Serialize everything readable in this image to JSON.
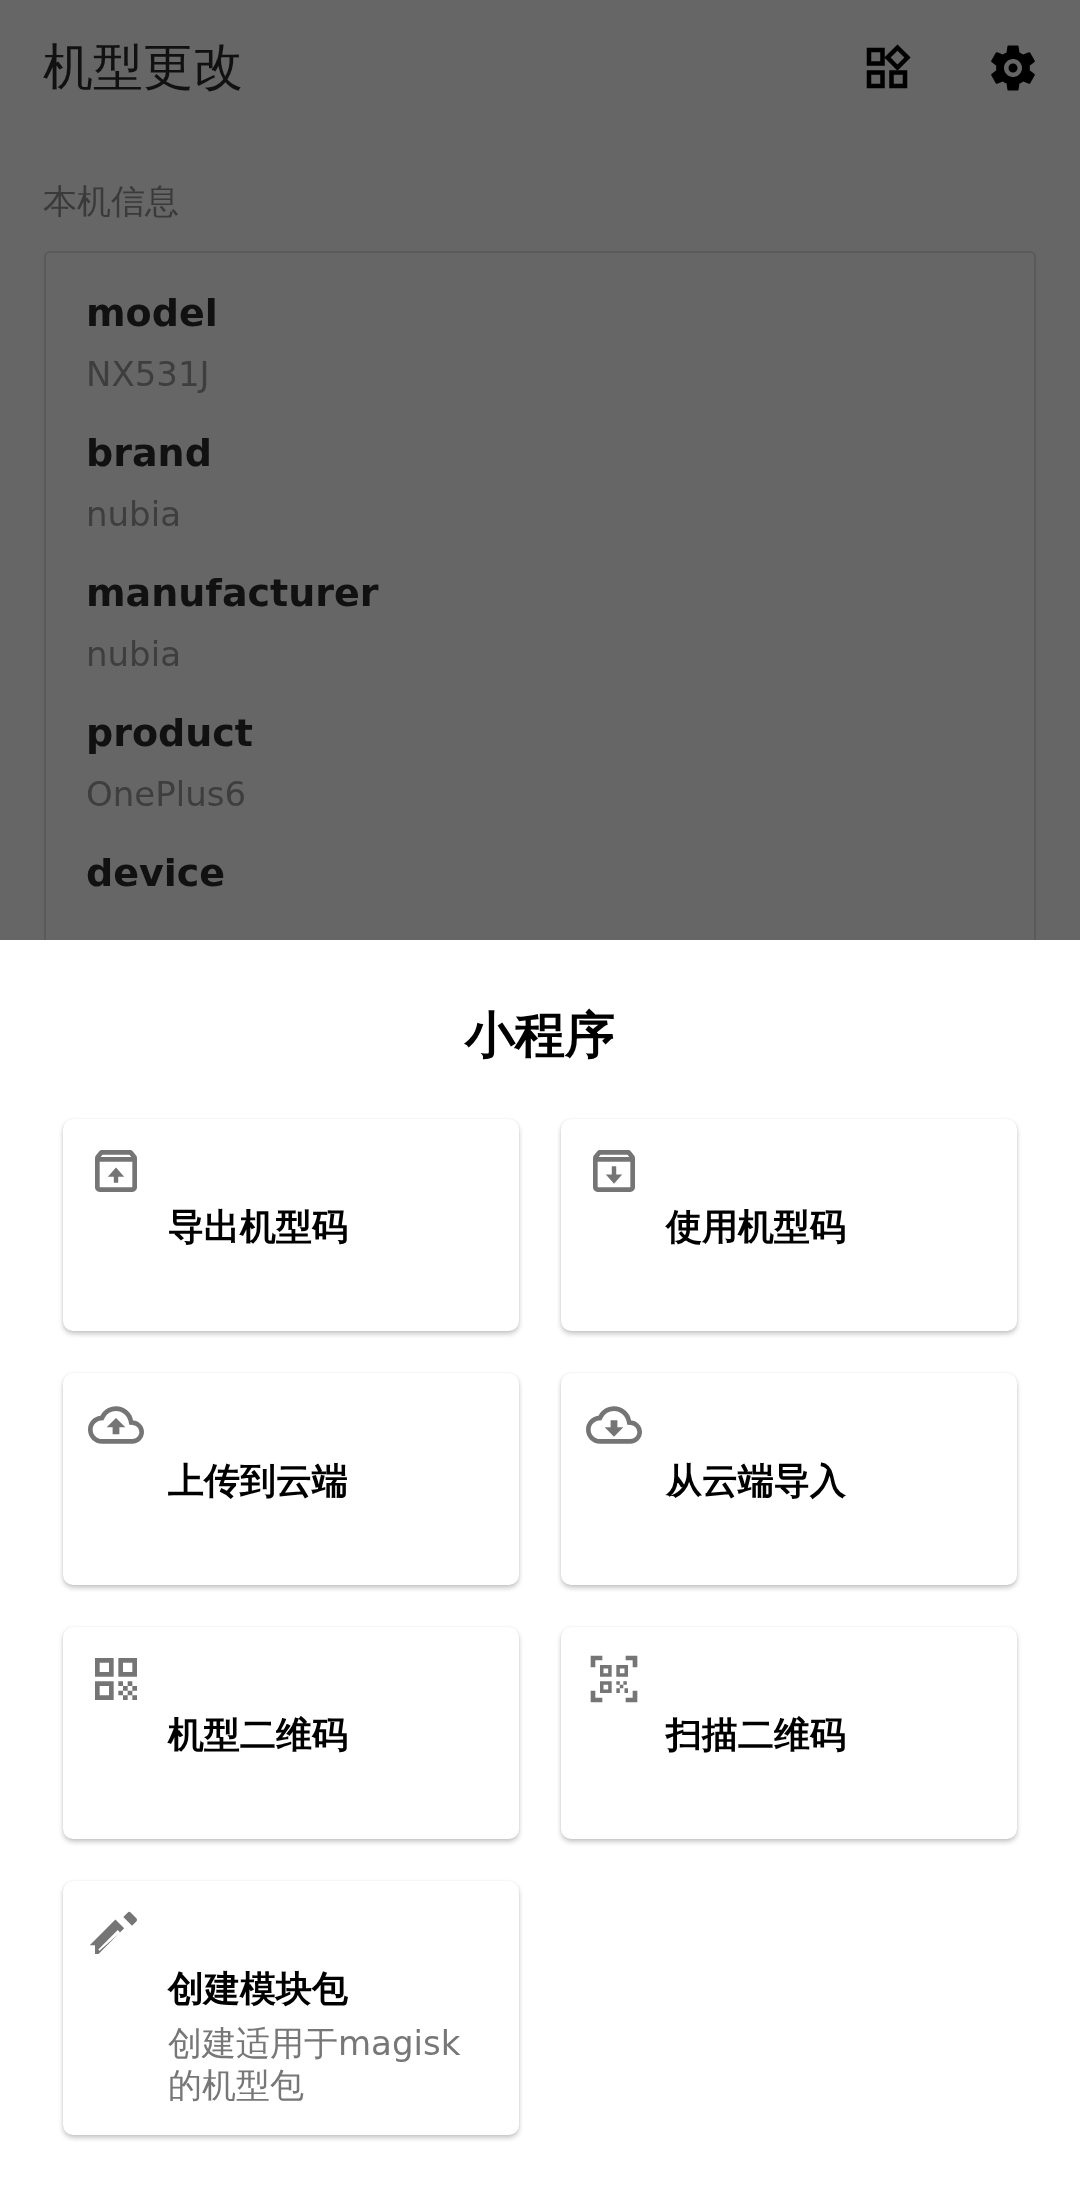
{
  "app_bar": {
    "title": "机型更改"
  },
  "section_label": "本机信息",
  "device_info": [
    {
      "key": "model",
      "value": "NX531J"
    },
    {
      "key": "brand",
      "value": "nubia"
    },
    {
      "key": "manufacturer",
      "value": "nubia"
    },
    {
      "key": "product",
      "value": "OnePlus6"
    },
    {
      "key": "device"
    }
  ],
  "bottom_sheet": {
    "title": "小程序",
    "items": [
      {
        "kind": "export",
        "label": "导出机型码"
      },
      {
        "kind": "import",
        "label": "使用机型码"
      },
      {
        "kind": "upload",
        "label": "上传到云端"
      },
      {
        "kind": "download",
        "label": "从云端导入"
      },
      {
        "kind": "qrcode",
        "label": "机型二维码"
      },
      {
        "kind": "scan",
        "label": "扫描二维码"
      },
      {
        "kind": "create",
        "label": "创建模块包",
        "subtitle": "创建适用于magisk的机型包"
      }
    ]
  }
}
